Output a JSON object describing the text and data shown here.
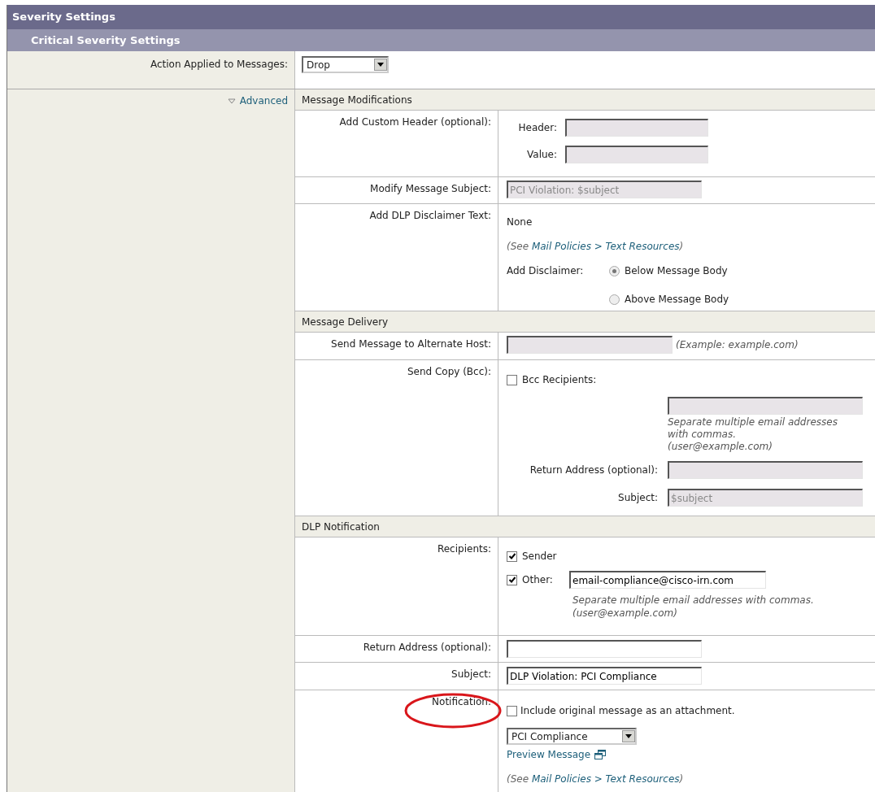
{
  "panel_title": "Severity Settings",
  "subpanel_title": "Critical Severity Settings",
  "action": {
    "label": "Action Applied to Messages:",
    "value": "Drop"
  },
  "advanced": {
    "label": "Advanced",
    "expanded": true
  },
  "message_modifications": {
    "title": "Message Modifications",
    "custom_header": {
      "label": "Add Custom Header (optional):",
      "header_label": "Header:",
      "header_field": {
        "disabled": true
      },
      "value_label": "Value:",
      "value_field": {
        "disabled": true
      }
    },
    "modify_subject": {
      "label": "Modify Message Subject:",
      "field": {
        "value": "PCI Violation: $subject",
        "disabled": true
      }
    },
    "disclaimer": {
      "label": "Add DLP Disclaimer Text:",
      "value": "None",
      "note": {
        "before": "(See ",
        "link": "Mail Policies > Text Resources",
        "after": ")"
      },
      "add_label": "Add Disclaimer:",
      "options": [
        {
          "label": "Below Message Body",
          "selected": true
        },
        {
          "label": "Above Message Body",
          "selected": false
        }
      ]
    }
  },
  "message_delivery": {
    "title": "Message Delivery",
    "alternate_host": {
      "label": "Send Message to Alternate Host:",
      "field": {
        "disabled": true
      },
      "hint": "(Example: example.com)"
    },
    "bcc": {
      "label": "Send Copy (Bcc):",
      "checkbox": {
        "label": "Bcc Recipients:",
        "checked": false
      },
      "field": {
        "disabled": true
      },
      "hint": "Separate multiple email addresses with commas.",
      "hint_example": "(user@example.com)",
      "return_label": "Return Address (optional):",
      "return_field": {
        "disabled": true
      },
      "subject_label": "Subject:",
      "subject_field": {
        "value": "$subject",
        "disabled": true
      }
    }
  },
  "dlp_notification": {
    "title": "DLP Notification",
    "recipients": {
      "label": "Recipients:",
      "sender": {
        "label": "Sender",
        "checked": true
      },
      "other": {
        "label": "Other:",
        "checked": true
      },
      "other_field": {
        "value": "email-compliance@cisco-irn.com",
        "disabled": false
      },
      "hint": "Separate multiple email addresses with commas.",
      "hint_example": "(user@example.com)"
    },
    "return_address": {
      "label": "Return Address (optional):",
      "field": {
        "disabled": false
      }
    },
    "subject": {
      "label": "Subject:",
      "field": {
        "value": "DLP Violation: PCI Compliance",
        "disabled": false
      }
    },
    "notification": {
      "label": "Notification:",
      "highlighted": true,
      "checkbox": {
        "label": "Include original message as an attachment.",
        "checked": false
      },
      "template": "PCI Compliance",
      "preview_link": "Preview Message",
      "note": {
        "before": "(See ",
        "link": "Mail Policies > Text Resources",
        "after": ")"
      }
    }
  }
}
